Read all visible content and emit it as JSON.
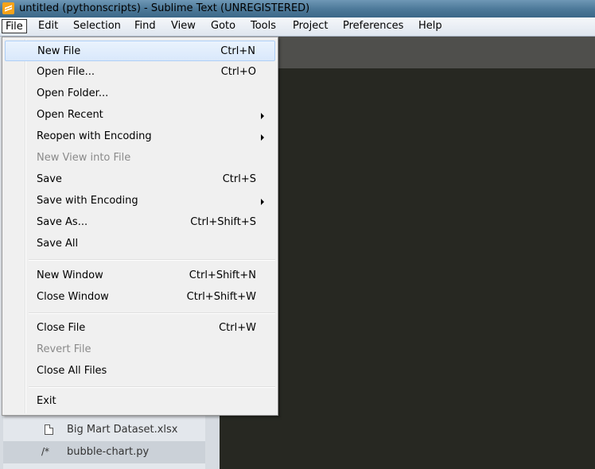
{
  "window": {
    "title": "untitled (pythonscripts) - Sublime Text (UNREGISTERED)"
  },
  "menubar": [
    "File",
    "Edit",
    "Selection",
    "Find",
    "View",
    "Goto",
    "Tools",
    "Project",
    "Preferences",
    "Help"
  ],
  "file_menu": {
    "new_file": {
      "label": "New File",
      "shortcut": "Ctrl+N"
    },
    "open_file": {
      "label": "Open File...",
      "shortcut": "Ctrl+O"
    },
    "open_folder": {
      "label": "Open Folder..."
    },
    "open_recent": {
      "label": "Open Recent"
    },
    "reopen_encoding": {
      "label": "Reopen with Encoding"
    },
    "new_view": {
      "label": "New View into File"
    },
    "save": {
      "label": "Save",
      "shortcut": "Ctrl+S"
    },
    "save_encoding": {
      "label": "Save with Encoding"
    },
    "save_as": {
      "label": "Save As...",
      "shortcut": "Ctrl+Shift+S"
    },
    "save_all": {
      "label": "Save All"
    },
    "new_window": {
      "label": "New Window",
      "shortcut": "Ctrl+Shift+N"
    },
    "close_window": {
      "label": "Close Window",
      "shortcut": "Ctrl+Shift+W"
    },
    "close_file": {
      "label": "Close File",
      "shortcut": "Ctrl+W"
    },
    "revert_file": {
      "label": "Revert File"
    },
    "close_all": {
      "label": "Close All Files"
    },
    "exit": {
      "label": "Exit"
    }
  },
  "sidebar": {
    "files": [
      {
        "name": "Big Mart Dataset.xlsx",
        "icon": "file-icon"
      },
      {
        "name": "bubble-chart.py",
        "icon": "/*"
      }
    ]
  }
}
